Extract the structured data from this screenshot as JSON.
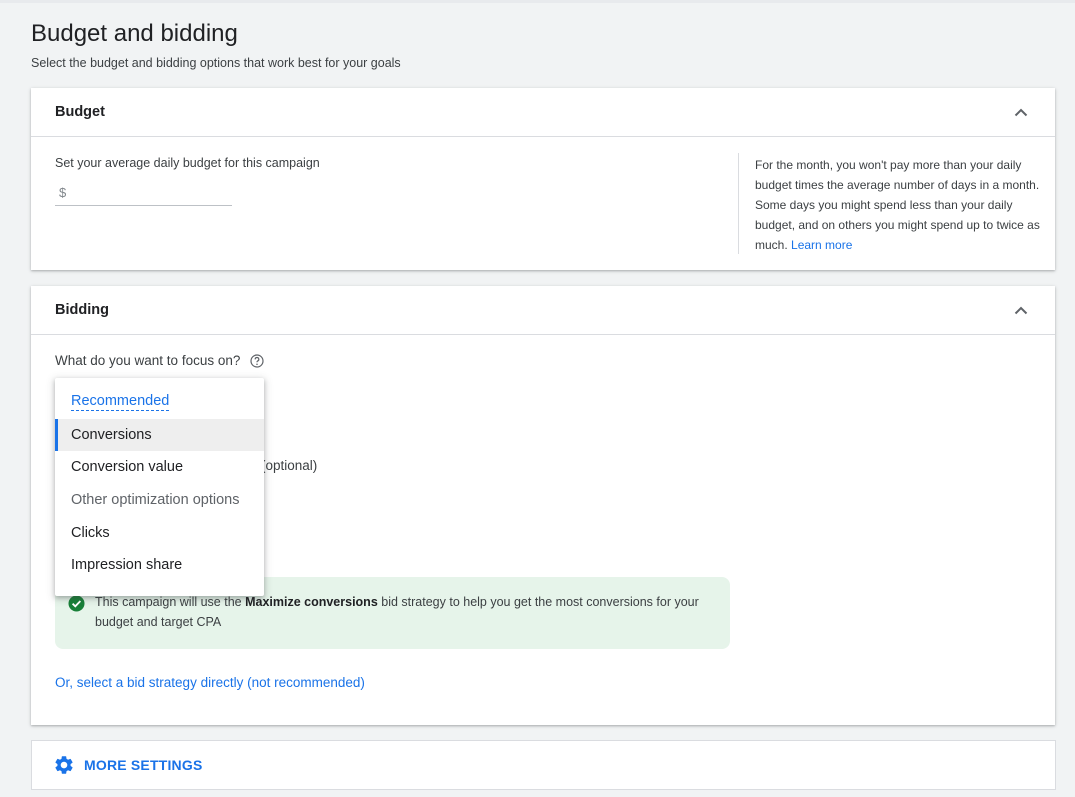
{
  "page": {
    "title": "Budget and bidding",
    "subtitle": "Select the budget and bidding options that work best for your goals"
  },
  "budget": {
    "header": "Budget",
    "label": "Set your average daily budget for this campaign",
    "currency_symbol": "$",
    "input_value": "",
    "help_text": "For the month, you won't pay more than your daily budget times the average number of days in a month. Some days you might spend less than your daily budget, and on others you might spend up to twice as much. ",
    "learn_more": "Learn more"
  },
  "bidding": {
    "header": "Bidding",
    "focus_question": "What do you want to focus on?",
    "optional_text": "(optional)",
    "info_prefix": "This campaign will use the ",
    "info_strategy": "Maximize conversions",
    "info_suffix": " bid strategy to help you get the most conversions for your budget and target CPA",
    "bid_strategy_link": "Or, select a bid strategy directly (not recommended)"
  },
  "dropdown": {
    "recommended_header": "Recommended",
    "items": [
      {
        "label": "Conversions",
        "selected": true
      },
      {
        "label": "Conversion value",
        "selected": false
      }
    ],
    "other_header": "Other optimization options",
    "other_items": [
      {
        "label": "Clicks"
      },
      {
        "label": "Impression share"
      }
    ]
  },
  "more_settings": {
    "label": "MORE SETTINGS"
  },
  "colors": {
    "accent": "#1a73e8",
    "success": "#188038",
    "info_bg": "#e6f4ea"
  },
  "icons": {
    "collapse": "chevron-up-icon",
    "help": "help-circle-icon",
    "check": "check-circle-icon",
    "settings": "gear-icon"
  }
}
